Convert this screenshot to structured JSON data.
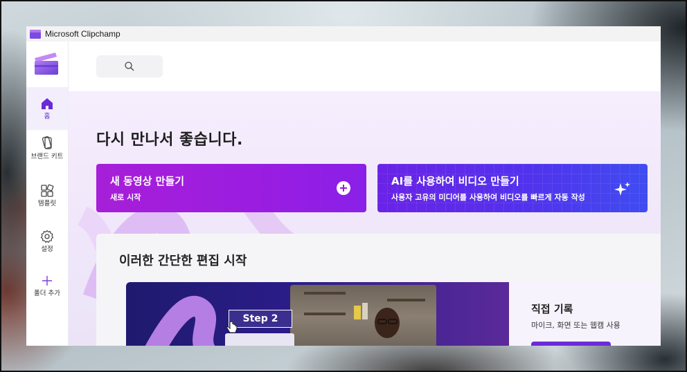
{
  "window": {
    "title": "Microsoft Clipchamp"
  },
  "sidebar": {
    "items": [
      {
        "label": "홈",
        "icon": "home-icon",
        "active": true
      },
      {
        "label": "브랜드 키트",
        "icon": "brand-kit-icon",
        "active": false
      },
      {
        "label": "템플릿",
        "icon": "templates-icon",
        "active": false
      },
      {
        "label": "설정",
        "icon": "gear-icon",
        "active": false
      },
      {
        "label": "폴더 추가",
        "icon": "plus-icon",
        "active": false
      }
    ]
  },
  "search": {
    "icon": "search-icon"
  },
  "main": {
    "welcome": "다시 만나서 좋습니다.",
    "cards": {
      "new_video": {
        "title": "새 동영상 만들기",
        "subtitle": "새로 시작"
      },
      "ai_video": {
        "title": "AI를 사용하여 비디오 만들기",
        "subtitle": "사용자 고유의 미디어를 사용하여 비디오를 빠르게 자동 작성"
      }
    },
    "quick_start": {
      "title": "이러한 간단한 편집 시작",
      "feature": {
        "step_label": "Step 2",
        "title": "직접 기록",
        "description": "마이크, 화면 또는 웹캠 사용"
      }
    }
  },
  "colors": {
    "accent": "#7b2bdc",
    "new_card": "#a21fdb",
    "ai_card": "#5232ec"
  }
}
